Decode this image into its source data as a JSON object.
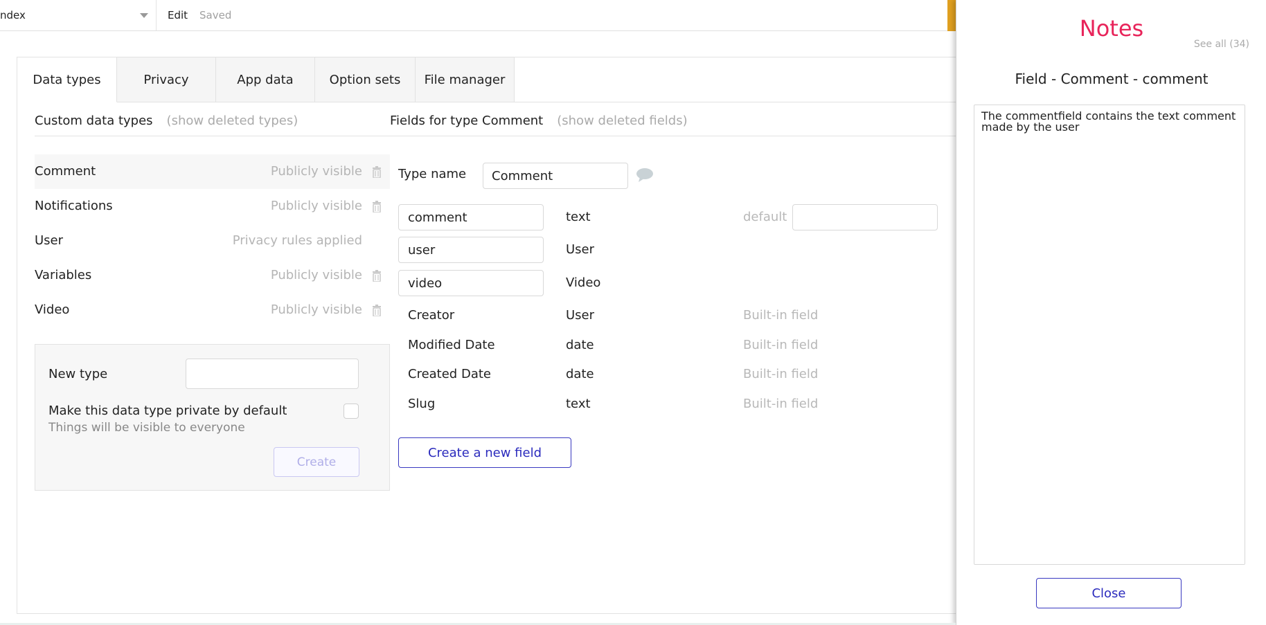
{
  "topbar": {
    "page_name": "ndex",
    "edit_label": "Edit",
    "saved_label": "Saved"
  },
  "tabs": [
    {
      "label": "Data types",
      "active": true
    },
    {
      "label": "Privacy"
    },
    {
      "label": "App data"
    },
    {
      "label": "Option sets"
    },
    {
      "label": "File manager"
    }
  ],
  "custom_types": {
    "heading": "Custom data types",
    "show_deleted": "(show deleted types)",
    "items": [
      {
        "name": "Comment",
        "status": "Publicly visible"
      },
      {
        "name": "Notifications",
        "status": "Publicly visible"
      },
      {
        "name": "User",
        "status": "Privacy rules applied"
      },
      {
        "name": "Variables",
        "status": "Publicly visible"
      },
      {
        "name": "Video",
        "status": "Publicly visible"
      }
    ]
  },
  "new_type": {
    "label": "New type",
    "value": "",
    "private_label": "Make this data type private by default",
    "private_sub": "Things will be visible to everyone",
    "create_label": "Create"
  },
  "fields": {
    "heading": "Fields for type Comment",
    "show_deleted": "(show deleted fields)",
    "type_name_label": "Type name",
    "type_name_value": "Comment",
    "rows": [
      {
        "name": "comment",
        "type": "text",
        "note": "default"
      },
      {
        "name": "user",
        "type": "User"
      },
      {
        "name": "video",
        "type": "Video"
      },
      {
        "name": "Creator",
        "type": "User",
        "note": "Built-in field"
      },
      {
        "name": "Modified Date",
        "type": "date",
        "note": "Built-in field"
      },
      {
        "name": "Created Date",
        "type": "date",
        "note": "Built-in field"
      },
      {
        "name": "Slug",
        "type": "text",
        "note": "Built-in field"
      }
    ],
    "new_field_label": "Create a new field"
  },
  "notes": {
    "title": "Notes",
    "see_all": "See all (34)",
    "subtitle": "Field - Comment - comment",
    "body": "The commentfield contains the text comment made by the user",
    "close_label": "Close"
  },
  "colors": {
    "notes_title": "#e8245a",
    "button_border": "#3838c0",
    "accent": "#e0a020"
  }
}
